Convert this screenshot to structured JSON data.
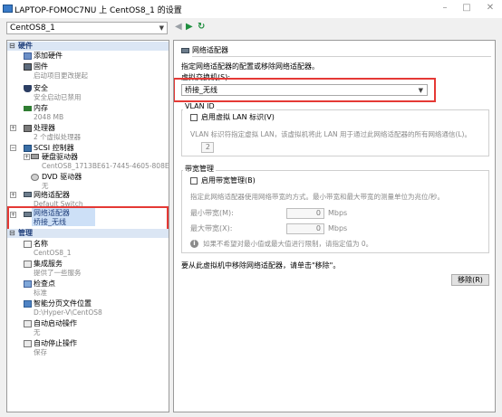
{
  "window": {
    "title": "LAPTOP-FOMOC7NU 上 CentOS8_1 的设置",
    "minimize_glyph": "–",
    "maximize_glyph": "□",
    "close_glyph": "✕"
  },
  "toolbar": {
    "vm_selected": "CentOS8_1",
    "back_glyph": "◀",
    "forward_glyph": "▶",
    "refresh_glyph": "↻"
  },
  "sidebar": {
    "hardware_header": "硬件",
    "management_header": "管理",
    "items": {
      "add_hardware": "添加硬件",
      "firmware": "固件",
      "firmware_sub": "启动项目更改提起",
      "security": "安全",
      "security_sub": "安全启动已禁用",
      "memory": "内存",
      "memory_sub": "2048 MB",
      "processor": "处理器",
      "processor_sub": "2 个虚拟处理器",
      "scsi": "SCSI 控制器",
      "hdd": "硬盘驱动器",
      "hdd_sub": "CentOS8_1713BE61-7445-4605-808E-C...",
      "dvd": "DVD 驱动器",
      "dvd_sub": "无",
      "net1": "网络适配器",
      "net1_sub": "Default Switch",
      "net2": "网络适配器",
      "net2_sub": "桥接_无线",
      "name": "名称",
      "name_sub": "CentOS8_1",
      "integration": "集成服务",
      "integration_sub": "提供了一些服务",
      "checkpoint": "检查点",
      "checkpoint_sub": "标准",
      "smartpaging": "智能分页文件位置",
      "smartpaging_sub": "D:\\Hyper-V\\CentOS8",
      "autostart": "自动启动操作",
      "autostart_sub": "无",
      "autostop": "自动停止操作",
      "autostop_sub": "保存"
    }
  },
  "main": {
    "section_title": "网络适配器",
    "description": "指定网络适配器的配置或移除网络适配器。",
    "switch_label": "虚拟交换机(S):",
    "switch_value": "桥接_无线",
    "vlan_title": "VLAN ID",
    "vlan_checkbox": "启用虚拟 LAN 标识(V)",
    "vlan_desc": "VLAN 标识符指定虚拟 LAN，该虚拟机将此 LAN 用于通过此网络适配器的所有网络通信(L)。",
    "vlan_value": "2",
    "bw_title": "带宽管理",
    "bw_checkbox": "启用带宽管理(B)",
    "bw_desc": "指定此网络适配器使用网络带宽的方式。最小带宽和最大带宽的测量单位为兆位/秒。",
    "min_bw_label": "最小带宽(M):",
    "min_bw_value": "0",
    "max_bw_label": "最大带宽(X):",
    "max_bw_value": "0",
    "unit": "Mbps",
    "bw_info": "如果不希望对最小值或最大值进行限制，请指定值为 0。",
    "remove_desc": "要从此虚拟机中移除网络适配器，请单击\"移除\"。",
    "remove_button": "移除(R)"
  },
  "colors": {
    "highlight_border": "#e53935",
    "selection_bg": "#cde0f7",
    "section_header_bg": "#dbe6f4"
  }
}
